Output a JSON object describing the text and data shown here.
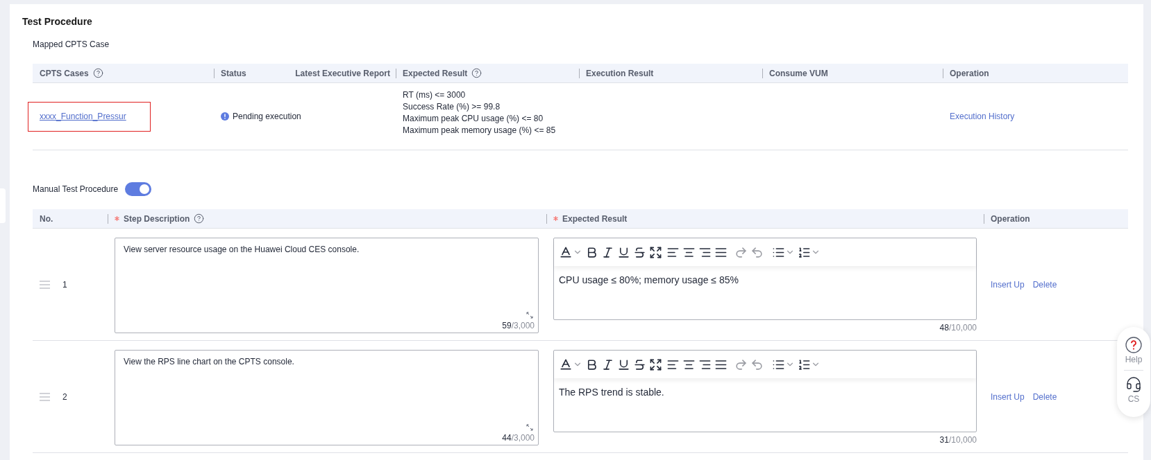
{
  "section_title": "Test Procedure",
  "mapped": {
    "title": "Mapped CPTS Case",
    "columns": [
      {
        "label": "CPTS Cases",
        "help": true
      },
      {
        "label": "Status",
        "help": false
      },
      {
        "label": "Latest Executive Report",
        "help": false
      },
      {
        "label": "Expected Result",
        "help": true
      },
      {
        "label": "Execution Result",
        "help": false
      },
      {
        "label": "Consume VUM",
        "help": false
      },
      {
        "label": "Operation",
        "help": false
      }
    ],
    "rows": [
      {
        "case": "xxxx_Function_Pressur",
        "highlighted": true,
        "status": "Pending execution",
        "expected_result": [
          "RT (ms) <= 3000",
          "Success Rate (%) >= 99.8",
          "Maximum peak CPU usage (%) <= 80",
          "Maximum peak memory usage (%) <= 85"
        ],
        "operation": "Execution History"
      }
    ]
  },
  "manual": {
    "label": "Manual Test Procedure",
    "on": true,
    "columns": [
      {
        "label": "No.",
        "required": false,
        "help": false
      },
      {
        "label": "Step Description",
        "required": true,
        "help": true
      },
      {
        "label": "Expected Result",
        "required": true,
        "help": false
      },
      {
        "label": "Operation",
        "required": false,
        "help": false
      }
    ],
    "steps": [
      {
        "no": "1",
        "description": "View server resource usage on the Huawei Cloud CES console.",
        "description_count": "59",
        "description_max": "/3,000",
        "expected": "CPU usage ≤ 80%; memory usage ≤ 85%",
        "expected_count": "48",
        "expected_max": "/10,000",
        "actions": [
          "Insert Up",
          "Delete"
        ]
      },
      {
        "no": "2",
        "description": "View the RPS line chart on the CPTS console.",
        "description_count": "44",
        "description_max": "/3,000",
        "expected": "The RPS trend is stable.",
        "expected_count": "31",
        "expected_max": "/10,000",
        "actions": [
          "Insert Up",
          "Delete"
        ]
      }
    ]
  },
  "float_menu": [
    {
      "kind": "help",
      "label": "Help"
    },
    {
      "kind": "cs",
      "label": "CS"
    }
  ]
}
